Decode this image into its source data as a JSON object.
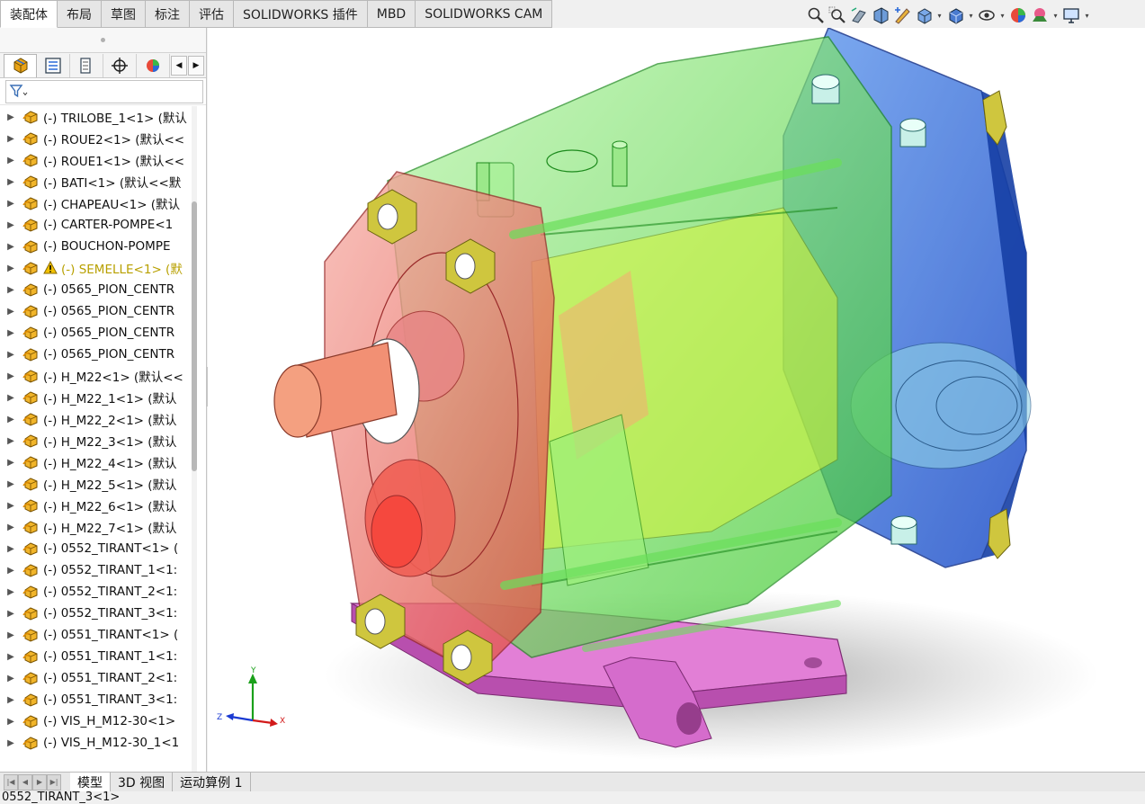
{
  "command_tabs": [
    "装配体",
    "布局",
    "草图",
    "标注",
    "评估",
    "SOLIDWORKS 插件",
    "MBD",
    "SOLIDWORKS CAM"
  ],
  "active_command_tab": 0,
  "hud_icons": [
    {
      "name": "zoom-to-fit-icon",
      "dropdown": false
    },
    {
      "name": "zoom-to-area-icon",
      "dropdown": false
    },
    {
      "name": "previous-view-icon",
      "dropdown": false
    },
    {
      "name": "section-view-icon",
      "dropdown": false
    },
    {
      "name": "dynamic-annotation-icon",
      "dropdown": false
    },
    {
      "name": "view-orientation-icon",
      "dropdown": true
    },
    {
      "name": "display-style-icon",
      "dropdown": true
    },
    {
      "name": "hide-show-items-icon",
      "dropdown": true
    },
    {
      "name": "edit-appearance-icon",
      "dropdown": false
    },
    {
      "name": "apply-scene-icon",
      "dropdown": true
    },
    {
      "name": "view-settings-icon",
      "dropdown": true
    }
  ],
  "manager_tabs": [
    "featuremanager-icon",
    "propertymanager-icon",
    "configurationmanager-icon",
    "dimxpert-icon",
    "display-manager-icon"
  ],
  "tree_items": [
    {
      "label": "(-) TRILOBE_1<1> (默认",
      "warning": false
    },
    {
      "label": "(-) ROUE2<1> (默认<<",
      "warning": false
    },
    {
      "label": "(-) ROUE1<1> (默认<<",
      "warning": false
    },
    {
      "label": "(-) BATI<1> (默认<<默",
      "warning": false
    },
    {
      "label": "(-) CHAPEAU<1> (默认",
      "warning": false
    },
    {
      "label": "(-) CARTER-POMPE<1",
      "warning": false
    },
    {
      "label": "(-) BOUCHON-POMPE",
      "warning": false
    },
    {
      "label": "(-) SEMELLE<1> (默",
      "warning": true
    },
    {
      "label": "(-) 0565_PION_CENTR",
      "warning": false
    },
    {
      "label": "(-) 0565_PION_CENTR",
      "warning": false
    },
    {
      "label": "(-) 0565_PION_CENTR",
      "warning": false
    },
    {
      "label": "(-) 0565_PION_CENTR",
      "warning": false
    },
    {
      "label": "(-) H_M22<1> (默认<<",
      "warning": false
    },
    {
      "label": "(-) H_M22_1<1> (默认",
      "warning": false
    },
    {
      "label": "(-) H_M22_2<1> (默认",
      "warning": false
    },
    {
      "label": "(-) H_M22_3<1> (默认",
      "warning": false
    },
    {
      "label": "(-) H_M22_4<1> (默认",
      "warning": false
    },
    {
      "label": "(-) H_M22_5<1> (默认",
      "warning": false
    },
    {
      "label": "(-) H_M22_6<1> (默认",
      "warning": false
    },
    {
      "label": "(-) H_M22_7<1> (默认",
      "warning": false
    },
    {
      "label": "(-) 0552_TIRANT<1> (",
      "warning": false
    },
    {
      "label": "(-) 0552_TIRANT_1<1:",
      "warning": false
    },
    {
      "label": "(-) 0552_TIRANT_2<1:",
      "warning": false
    },
    {
      "label": "(-) 0552_TIRANT_3<1:",
      "warning": false
    },
    {
      "label": "(-) 0551_TIRANT<1> (",
      "warning": false
    },
    {
      "label": "(-) 0551_TIRANT_1<1:",
      "warning": false
    },
    {
      "label": "(-) 0551_TIRANT_2<1:",
      "warning": false
    },
    {
      "label": "(-) 0551_TIRANT_3<1:",
      "warning": false
    },
    {
      "label": "(-) VIS_H_M12-30<1>",
      "warning": false
    },
    {
      "label": "(-) VIS_H_M12-30_1<1",
      "warning": false
    }
  ],
  "triad": {
    "x": "X",
    "y": "Y",
    "z": "Z"
  },
  "bottom_tabs": [
    "模型",
    "3D 视图",
    "运动算例 1"
  ],
  "active_bottom_tab": 0,
  "status_text": "0552_TIRANT_3<1>",
  "colors": {
    "accent": "#1f5fbf",
    "component_icon": "#e8a317",
    "warning": "#f2c100",
    "pump_blue": "#2f5fd1",
    "pump_green": "#4fdc3a",
    "pump_red": "#f0584c",
    "base_pink": "#e070d0",
    "nut_olive": "#c9c23a"
  }
}
